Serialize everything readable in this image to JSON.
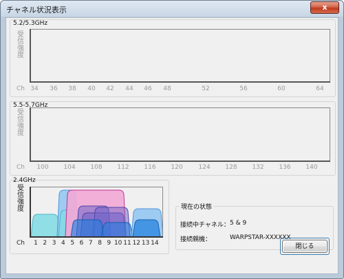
{
  "window": {
    "title": "チャネル状況表示",
    "close_glyph": "x"
  },
  "band_5_2": {
    "label": "5.2/5.3GHz",
    "ylabel": "受信強度",
    "ch_label": "Ch",
    "ticks": [
      "34",
      "36",
      "38",
      "40",
      "42",
      "44",
      "46",
      "48",
      "52",
      "56",
      "60",
      "64"
    ]
  },
  "band_5_5": {
    "label": "5.5-5.7GHz",
    "ylabel": "受信強度",
    "ch_label": "Ch",
    "ticks": [
      "100",
      "104",
      "108",
      "112",
      "116",
      "120",
      "124",
      "128",
      "132",
      "136",
      "140"
    ]
  },
  "band_2_4": {
    "label": "2.4GHz",
    "ylabel": "受信強度",
    "ch_label": "Ch",
    "ticks": [
      "1",
      "2",
      "3",
      "4",
      "5",
      "6",
      "7",
      "8",
      "9",
      "10",
      "11",
      "12",
      "13",
      "14"
    ],
    "colors": {
      "cyan": "#7fdbe4",
      "light_blue": "#8fc4f2",
      "blue": "#1e7fe0",
      "purple": "#6f63c8",
      "pink": "#f2a8d6",
      "magenta_line": "#c0308f"
    }
  },
  "status": {
    "title": "現在の状態",
    "channel_label": "接続中チャネル：",
    "channel_value": "5 & 9",
    "parent_label": "接続親機：",
    "parent_value": "WARPSTAR-XXXXXX"
  },
  "buttons": {
    "close_label": "閉じる"
  }
}
